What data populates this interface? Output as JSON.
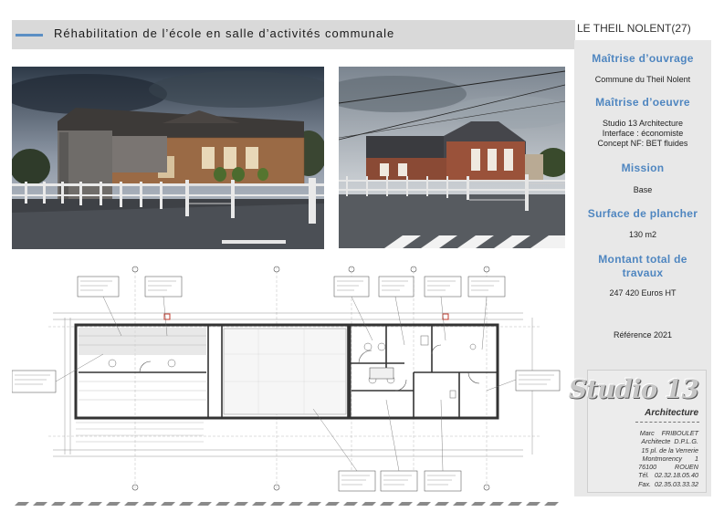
{
  "header": {
    "title": "Réhabilitation de l’école en salle d’activités communale",
    "location": "LE THEIL NOLENT(27)"
  },
  "panel": {
    "maitrise_ouvrage_title": "Maîtrise d’ouvrage",
    "maitrise_ouvrage_text": "Commune du Theil Nolent",
    "maitrise_oeuvre_title": "Maîtrise d’oeuvre",
    "maitrise_oeuvre_lines": [
      "Studio 13 Architecture",
      "Interface : économiste",
      "Concept NF: BET fluides"
    ],
    "mission_title": "Mission",
    "mission_text": "Base",
    "surface_title": "Surface de plancher",
    "surface_text": "130 m2",
    "montant_title_1": "Montant total de",
    "montant_title_2": "travaux",
    "montant_text": "247 420 Euros HT",
    "reference": "Référence 2021"
  },
  "logo": {
    "brand": "Studio 13",
    "sub": "Architecture",
    "lines": [
      "Marc    FRIBOULET",
      "Architecte  D.P.L.G.",
      "15 pl. de la Verrerie",
      "Montmorency       1",
      "76100          ROUEN",
      "Tél.   02.32.18.05.40",
      "Fax.  02.35.03.33.32"
    ]
  },
  "colors": {
    "accent": "#5b8fc4",
    "panel_bg": "#e8e8e8",
    "header_bg": "#d9d9d9",
    "section_title": "#4f86c0"
  }
}
